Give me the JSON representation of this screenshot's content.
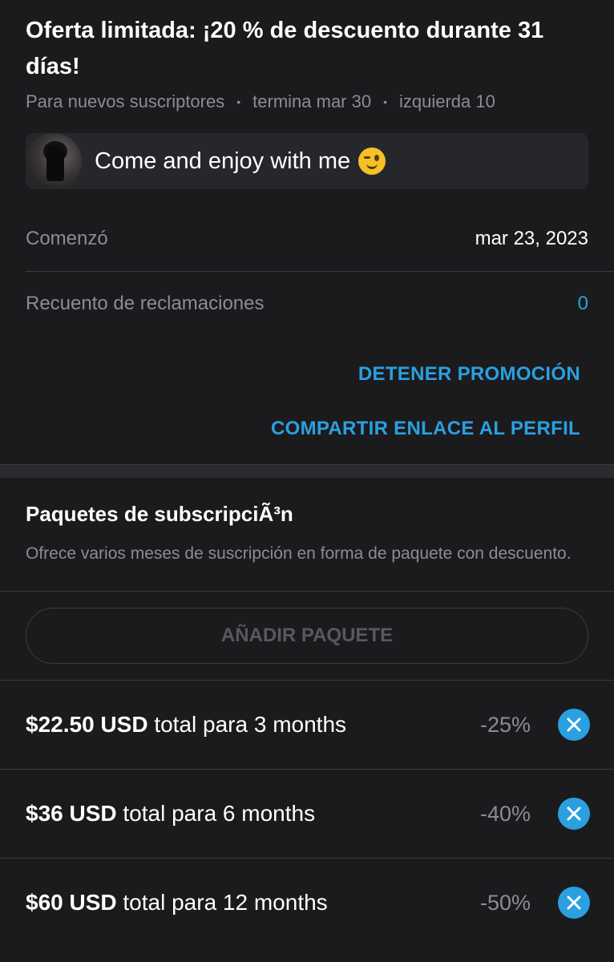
{
  "promo": {
    "title": "Oferta limitada: ¡20 % de descuento durante 31 días!",
    "audience": "Para nuevos suscriptores",
    "ends": "termina mar 30",
    "remaining": "izquierda 10",
    "message": "Come and enjoy with me",
    "emoji": "winking-face"
  },
  "details": {
    "started_label": "Comenzó",
    "started_value": "mar 23, 2023",
    "claims_label": "Recuento de reclamaciones",
    "claims_value": "0"
  },
  "actions": {
    "stop": "DETENER PROMOCIÓN",
    "share": "COMPARTIR ENLACE AL PERFIL"
  },
  "bundles": {
    "title": "Paquetes de subscripciÃ³n",
    "description": "Ofrece varios meses de suscripción en forma de paquete con descuento.",
    "add_label": "AÑADIR PAQUETE",
    "items": [
      {
        "price": "$22.50 USD",
        "rest": "total para 3 months",
        "discount": "-25%"
      },
      {
        "price": "$36 USD",
        "rest": "total para 6 months",
        "discount": "-40%"
      },
      {
        "price": "$60 USD",
        "rest": "total para 12 months",
        "discount": "-50%"
      }
    ]
  },
  "colors": {
    "background": "#1b1b1d",
    "accent": "#2aa0e0",
    "muted_text": "#8a8d93"
  }
}
